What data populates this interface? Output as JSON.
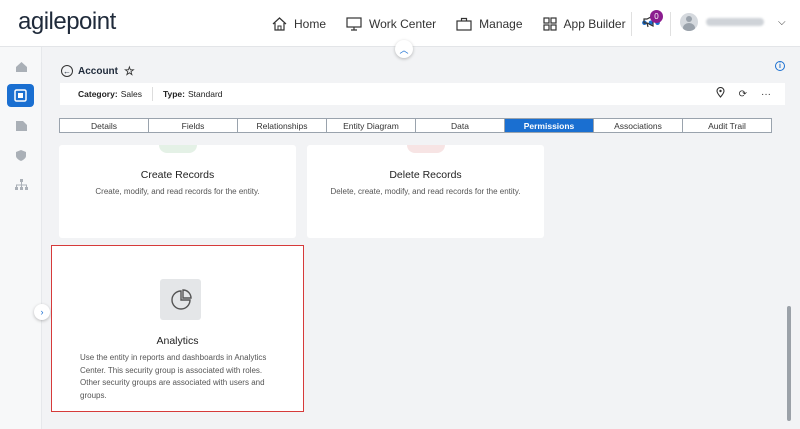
{
  "app": {
    "logo_text": "agilepoint"
  },
  "nav": {
    "items": [
      {
        "label": "Home",
        "icon": "home-icon"
      },
      {
        "label": "Work Center",
        "icon": "monitor-icon"
      },
      {
        "label": "Manage",
        "icon": "briefcase-icon"
      },
      {
        "label": "App Builder",
        "icon": "grid-icon"
      }
    ],
    "more": "•••",
    "notification_count": "0"
  },
  "entity": {
    "title": "Account",
    "category_label": "Category:",
    "category_value": "Sales",
    "type_label": "Type:",
    "type_value": "Standard"
  },
  "tabs": [
    {
      "label": "Details",
      "active": false
    },
    {
      "label": "Fields",
      "active": false
    },
    {
      "label": "Relationships",
      "active": false
    },
    {
      "label": "Entity Diagram",
      "active": false
    },
    {
      "label": "Data",
      "active": false
    },
    {
      "label": "Permissions",
      "active": true
    },
    {
      "label": "Associations",
      "active": false
    },
    {
      "label": "Audit Trail",
      "active": false
    }
  ],
  "cards": {
    "create": {
      "title": "Create Records",
      "desc": "Create, modify, and read records for the entity."
    },
    "delete": {
      "title": "Delete Records",
      "desc": "Delete, create, modify, and read records for the entity."
    },
    "analytics": {
      "title": "Analytics",
      "desc": "Use the entity in reports and dashboards in Analytics Center. This security group is associated with roles. Other security groups are associated with users and groups."
    }
  },
  "colors": {
    "accent": "#1a6fd1",
    "highlight": "#d63a3a",
    "badge": "#8b1d8f"
  }
}
